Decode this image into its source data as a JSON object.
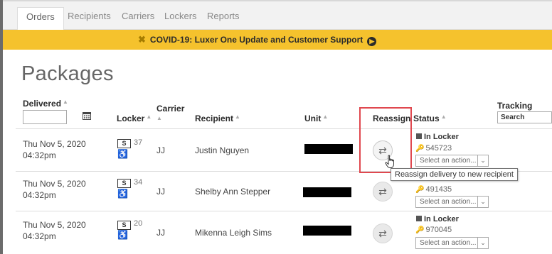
{
  "tabs": [
    "Orders",
    "Recipients",
    "Carriers",
    "Lockers",
    "Reports"
  ],
  "active_tab": "Orders",
  "banner": {
    "close": "✖",
    "text": "COVID-19: Luxer One Update and Customer Support",
    "icon": "arrow-circle-right-icon"
  },
  "page_title": "Packages",
  "columns": {
    "delivered": "Delivered",
    "locker": "Locker",
    "carrier": "Carrier",
    "recipient": "Recipient",
    "unit": "Unit",
    "reassign": "Reassign",
    "status": "Status",
    "tracking": "Tracking"
  },
  "filters": {
    "delivered_value": "",
    "tracking_search": "Search"
  },
  "rows": [
    {
      "date": "Thu Nov 5, 2020",
      "time": "04:32pm",
      "locker_size": "S",
      "locker_number": "37",
      "carrier": "JJ",
      "recipient": "Justin Nguyen",
      "status": "In Locker",
      "code": "545723",
      "action": "Select an action..."
    },
    {
      "date": "Thu Nov 5, 2020",
      "time": "04:32pm",
      "locker_size": "S",
      "locker_number": "34",
      "carrier": "JJ",
      "recipient": "Shelby Ann Stepper",
      "status": "",
      "code": "491435",
      "action": "Select an action..."
    },
    {
      "date": "Thu Nov 5, 2020",
      "time": "04:32pm",
      "locker_size": "S",
      "locker_number": "20",
      "carrier": "JJ",
      "recipient": "Mikenna Leigh Sims",
      "status": "In Locker",
      "code": "970045",
      "action": "Select an action..."
    }
  ],
  "tooltip": "Reassign delivery to new recipient",
  "colors": {
    "banner": "#f5c22d",
    "highlight": "#e0484f",
    "tab_bar": "#f2f2f2"
  }
}
